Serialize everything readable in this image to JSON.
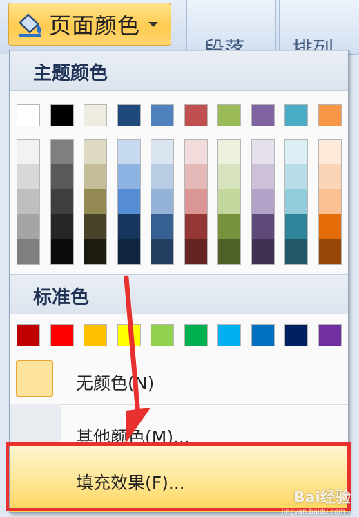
{
  "ribbon": {
    "button_label": "页面颜色",
    "group_fragment_1": "段落",
    "group_fragment_2": "排列"
  },
  "menu": {
    "theme_colors_title": "主题颜色",
    "theme_colors": [
      "#ffffff",
      "#000000",
      "#eeece1",
      "#1f497d",
      "#4f81bd",
      "#c0504d",
      "#9bbb59",
      "#8064a2",
      "#4bacc6",
      "#f79646"
    ],
    "theme_shades": [
      [
        "#f2f2f2",
        "#d8d8d8",
        "#bfbfbf",
        "#a5a5a5",
        "#7f7f7f"
      ],
      [
        "#7f7f7f",
        "#595959",
        "#3f3f3f",
        "#262626",
        "#0c0c0c"
      ],
      [
        "#ddd9c3",
        "#c4bd97",
        "#938953",
        "#494429",
        "#1d1b10"
      ],
      [
        "#c6d9f0",
        "#8db3e2",
        "#548dd4",
        "#17365d",
        "#0f243e"
      ],
      [
        "#dbe5f1",
        "#b8cce4",
        "#95b3d7",
        "#366092",
        "#244061"
      ],
      [
        "#f2dcdb",
        "#e5b9b7",
        "#d99694",
        "#953734",
        "#632423"
      ],
      [
        "#ebf1dd",
        "#d7e3bc",
        "#c3d69b",
        "#76923c",
        "#4f6128"
      ],
      [
        "#e5e0ec",
        "#ccc1d9",
        "#b2a2c7",
        "#5f497a",
        "#3f3151"
      ],
      [
        "#dbeef3",
        "#b7dde8",
        "#92cddc",
        "#31859b",
        "#205867"
      ],
      [
        "#fdeada",
        "#fbd5b5",
        "#fac08f",
        "#e36c09",
        "#974806"
      ]
    ],
    "standard_colors_title": "标准色",
    "standard_colors": [
      "#c00000",
      "#ff0000",
      "#ffc000",
      "#ffff00",
      "#92d050",
      "#00b050",
      "#00b0f0",
      "#0070c0",
      "#002060",
      "#7030a0"
    ],
    "no_color_label": "无颜色(N)",
    "more_colors_label": "其他颜色(M)...",
    "fill_effects_label": "填充效果(F)..."
  },
  "watermark": {
    "brand": "Bai经验",
    "url": "jingyan.baidu.com"
  }
}
